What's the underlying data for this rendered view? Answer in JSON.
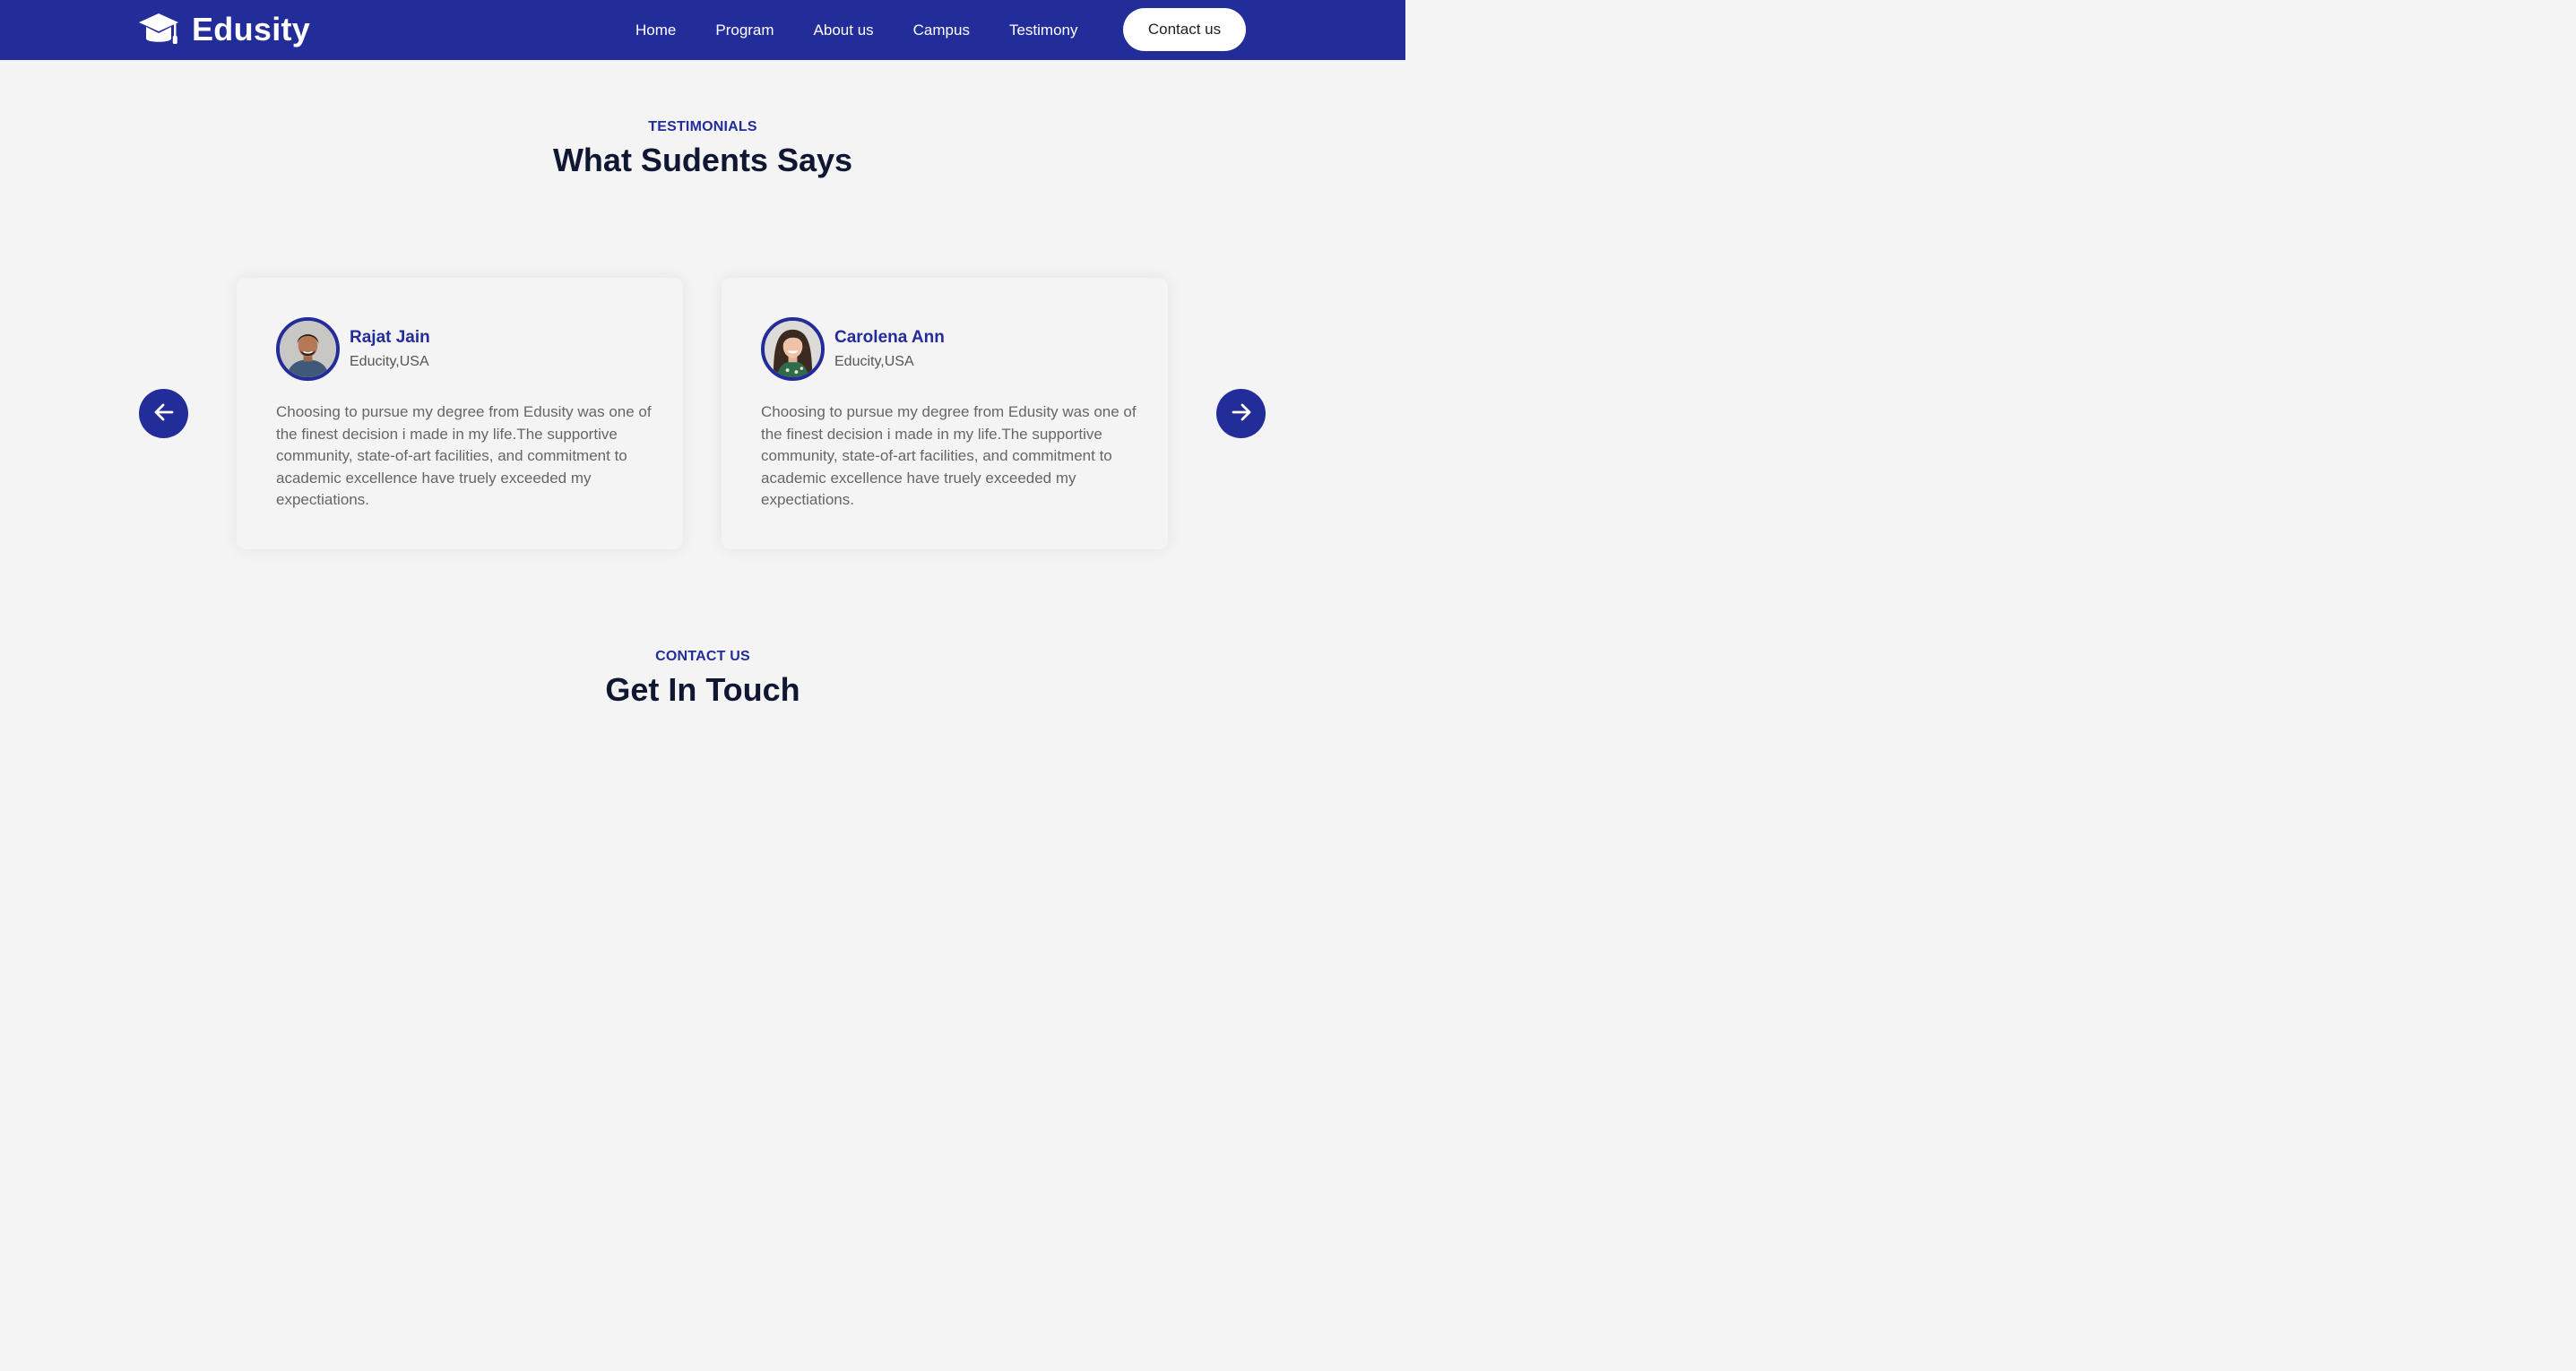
{
  "brand": {
    "name": "Edusity",
    "icon": "graduation-cap-icon"
  },
  "nav": {
    "links": [
      "Home",
      "Program",
      "About us",
      "Campus",
      "Testimony"
    ],
    "contact_label": "Contact us"
  },
  "testimonials": {
    "subtitle": "TESTIMONIALS",
    "title": "What Sudents Says",
    "cards": [
      {
        "name": "Rajat Jain",
        "org": "Educity,USA",
        "text": "Choosing to pursue my degree from Edusity was one of the finest decision i made in my life.The supportive community, state-of-art facilities, and commitment to academic excellence have truely exceeded my expectiations."
      },
      {
        "name": "Carolena Ann",
        "org": "Educity,USA",
        "text": "Choosing to pursue my degree from Edusity was one of the finest decision i made in my life.The supportive community, state-of-art facilities, and commitment to academic excellence have truely exceeded my expectiations."
      }
    ],
    "prev_icon": "arrow-left-icon",
    "next_icon": "arrow-right-icon"
  },
  "contact": {
    "subtitle": "CONTACT US",
    "title": "Get In Touch"
  },
  "colors": {
    "primary": "#232d9a",
    "background": "#f4f4f4",
    "heading": "#0f1733",
    "body_text": "#666666"
  }
}
